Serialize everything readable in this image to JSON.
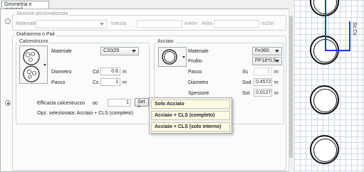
{
  "tab": {
    "label": "Geometria e materiali"
  },
  "custom_section": {
    "title": "Sezione personalizzata",
    "material_label": "Materiale",
    "inertia_label": "Inerzia",
    "inertia_unit": "m4/m",
    "area_label": "Area",
    "area_unit": "m2/m"
  },
  "diaphragm": {
    "title": "Diaframma o Pali",
    "concrete": {
      "title": "Calcestruzzo",
      "material_label": "Materiale",
      "material_value": "C20/25",
      "diameter_label": "Diametro",
      "diameter_symbol": "Cd",
      "diameter_value": "0.6",
      "diameter_unit": "m",
      "spacing_label": "Passo",
      "spacing_symbol": "Cs",
      "spacing_value": "1",
      "spacing_unit": "m",
      "efficacy_label": "Efficacia calcestruzzo",
      "efficacy_symbol": "αc",
      "efficacy_value": "1",
      "set_button": "Set >",
      "selected_option_text": "Opz. selezionata: Acciaio + CLS (completo)"
    },
    "steel": {
      "title": "Acciaio",
      "material_label": "Materiale",
      "material_value": "Fe360",
      "profile_label": "Profilo",
      "profile_value": "PP18*0.5",
      "spacing_label": "Passo",
      "spacing_symbol": "Ss",
      "spacing_value": "1",
      "spacing_unit": "m",
      "diameter_label": "Diametro",
      "diameter_symbol": "Sod",
      "diameter_value": "0.4572",
      "diameter_unit": "m",
      "thickness_label": "Spessore",
      "thickness_symbol": "Sot",
      "thickness_value": "0.0127",
      "thickness_unit": "m"
    }
  },
  "popup_menu": {
    "items": [
      "Solo Acciaio",
      "Acciaio + CLS (completo)",
      "Acciaio + CLS (solo interno)"
    ]
  },
  "drawing": {
    "label": "Ss Cs"
  }
}
